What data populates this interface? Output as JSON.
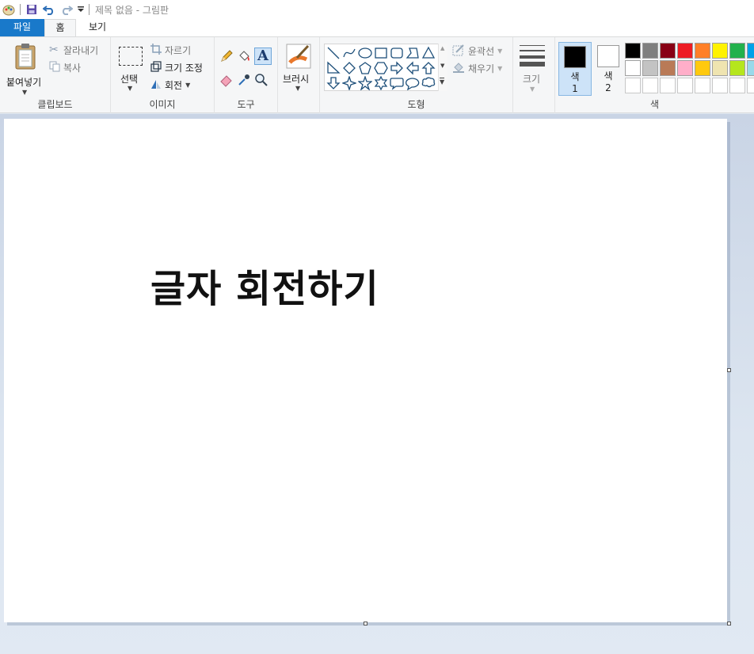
{
  "window": {
    "title": "제목 없음 - 그림판"
  },
  "quick_access": {
    "icons": [
      "paint-app-icon",
      "save-icon",
      "undo-icon",
      "redo-icon",
      "customize-dropdown-icon"
    ]
  },
  "tabs": {
    "file": "파일",
    "home": "홈",
    "view": "보기"
  },
  "ribbon": {
    "clipboard": {
      "label": "클립보드",
      "paste": "붙여넣기",
      "cut": "잘라내기",
      "copy": "복사"
    },
    "image": {
      "label": "이미지",
      "select": "선택",
      "crop": "자르기",
      "resize": "크기 조정",
      "rotate": "회전"
    },
    "tools": {
      "label": "도구",
      "icons": [
        "pencil-icon",
        "fill-icon",
        "text-icon",
        "eraser-icon",
        "color-picker-icon",
        "magnifier-icon"
      ]
    },
    "brushes": {
      "label": "브러시"
    },
    "shapes": {
      "label": "도형",
      "outline": "윤곽선",
      "fill": "채우기",
      "items": [
        "line",
        "curve",
        "oval",
        "rectangle",
        "rounded-rectangle",
        "polygon",
        "triangle",
        "right-triangle",
        "diamond",
        "pentagon",
        "hexagon",
        "right-arrow",
        "left-arrow",
        "up-arrow",
        "down-arrow",
        "four-point-star",
        "five-point-star",
        "six-point-star",
        "rounded-callout",
        "oval-callout",
        "cloud-callout"
      ]
    },
    "size": {
      "label": "크기"
    },
    "colors": {
      "label": "색",
      "color1": {
        "label": "색",
        "num": "1",
        "value": "#000000"
      },
      "color2": {
        "label": "색",
        "num": "2",
        "value": "#ffffff"
      },
      "palette_row1": [
        "#000000",
        "#7f7f7f",
        "#880015",
        "#ed1c24",
        "#ff7f27",
        "#fff200",
        "#22b14c",
        "#00a2e8"
      ],
      "palette_row2": [
        "#ffffff",
        "#c3c3c3",
        "#b97a57",
        "#ffaec9",
        "#ffc90e",
        "#efe4b0",
        "#b5e61d",
        "#99d9ea"
      ],
      "palette_row3": [
        "#ffffff",
        "#ffffff",
        "#ffffff",
        "#ffffff",
        "#ffffff",
        "#ffffff",
        "#ffffff",
        "#ffffff"
      ]
    }
  },
  "canvas": {
    "text": "글자 회전하기"
  }
}
